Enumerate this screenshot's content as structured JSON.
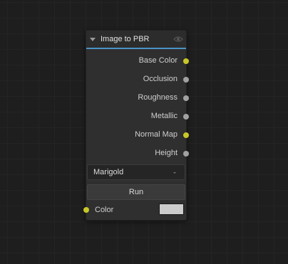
{
  "node": {
    "title": "Image to PBR",
    "title_icon": "eye-icon",
    "accent_color": "#4a93c5",
    "outputs": [
      {
        "label": "Base Color",
        "socket": "color"
      },
      {
        "label": "Occlusion",
        "socket": "float"
      },
      {
        "label": "Roughness",
        "socket": "float"
      },
      {
        "label": "Metallic",
        "socket": "float"
      },
      {
        "label": "Normal Map",
        "socket": "color"
      },
      {
        "label": "Height",
        "socket": "float"
      }
    ],
    "model_select": {
      "value": "Marigold"
    },
    "run_label": "Run",
    "input": {
      "label": "Color",
      "socket": "color",
      "value_color": "#cccccc"
    }
  },
  "socket_colors": {
    "color": "#c7c729",
    "float": "#a1a1a1"
  }
}
